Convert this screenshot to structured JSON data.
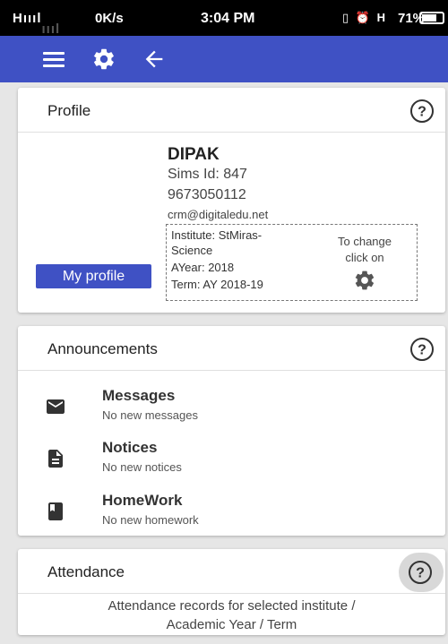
{
  "status_bar": {
    "signal": "H",
    "network_speed": "0K/s",
    "time": "3:04 PM",
    "battery_percent": "71%",
    "battery_level": 0.71
  },
  "app_bar": {
    "color": "#3f51c4",
    "icons": [
      "menu-icon",
      "gear-icon",
      "back-arrow-icon"
    ]
  },
  "profile": {
    "title": "Profile",
    "name": "DIPAK",
    "sims_id": "Sims Id: 847",
    "phone": "9673050112",
    "email": "crm@digitaledu.net",
    "institute_line1": "Institute: StMiras-",
    "institute_line2": "Science",
    "ayear": "AYear: 2018",
    "term": "Term: AY 2018-19",
    "change_line1": "To change",
    "change_line2": "click on",
    "my_profile_label": "My profile"
  },
  "announcements": {
    "title": "Announcements",
    "items": [
      {
        "title": "Messages",
        "subtitle": "No new messages",
        "icon": "mail-icon"
      },
      {
        "title": "Notices",
        "subtitle": "No new notices",
        "icon": "document-icon"
      },
      {
        "title": "HomeWork",
        "subtitle": "No new homework",
        "icon": "book-icon"
      }
    ]
  },
  "attendance": {
    "title": "Attendance",
    "text_line1": "Attendance records for selected institute /",
    "text_line2": "Academic Year / Term"
  }
}
